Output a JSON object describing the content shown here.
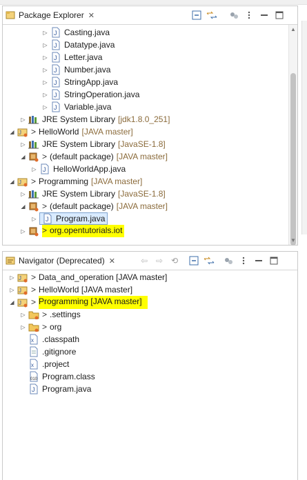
{
  "package_explorer": {
    "title": "Package Explorer",
    "close": "✕",
    "tree": [
      {
        "label": "Casting.java"
      },
      {
        "label": "Datatype.java"
      },
      {
        "label": "Letter.java"
      },
      {
        "label": "Number.java"
      },
      {
        "label": "StringApp.java"
      },
      {
        "label": "StringOperation.java"
      },
      {
        "label": "Variable.java"
      },
      {
        "label": "JRE System Library",
        "decoration": "[jdk1.8.0_251]"
      },
      {
        "prefix": ">",
        "label": "HelloWorld",
        "decoration": "[JAVA master]"
      },
      {
        "label": "JRE System Library",
        "decoration": "[JavaSE-1.8]"
      },
      {
        "prefix": ">",
        "label": "(default package)",
        "decoration": "[JAVA master]"
      },
      {
        "label": "HelloWorldApp.java"
      },
      {
        "prefix": ">",
        "label": "Programming",
        "decoration": "[JAVA master]"
      },
      {
        "label": "JRE System Library",
        "decoration": "[JavaSE-1.8]"
      },
      {
        "prefix": ">",
        "label": "(default package)",
        "decoration": "[JAVA master]"
      },
      {
        "label": "Program.java"
      },
      {
        "prefix": ">",
        "label": "org.opentutorials.iot"
      }
    ]
  },
  "navigator": {
    "title": "Navigator (Deprecated)",
    "close": "✕",
    "tree": [
      {
        "prefix": ">",
        "label": "Data_and_operation [JAVA master]"
      },
      {
        "prefix": ">",
        "label": "HelloWorld [JAVA master]"
      },
      {
        "prefix": ">",
        "label": "Programming [JAVA master]"
      },
      {
        "prefix": ">",
        "label": ".settings"
      },
      {
        "prefix": ">",
        "label": "org"
      },
      {
        "label": ".classpath"
      },
      {
        "label": ".gitignore"
      },
      {
        "label": ".project"
      },
      {
        "label": "Program.class"
      },
      {
        "label": "Program.java"
      }
    ]
  },
  "colors": {
    "highlight": "#ffff00",
    "selection": "#d9ebff",
    "decoration": "#8a6a3a"
  }
}
